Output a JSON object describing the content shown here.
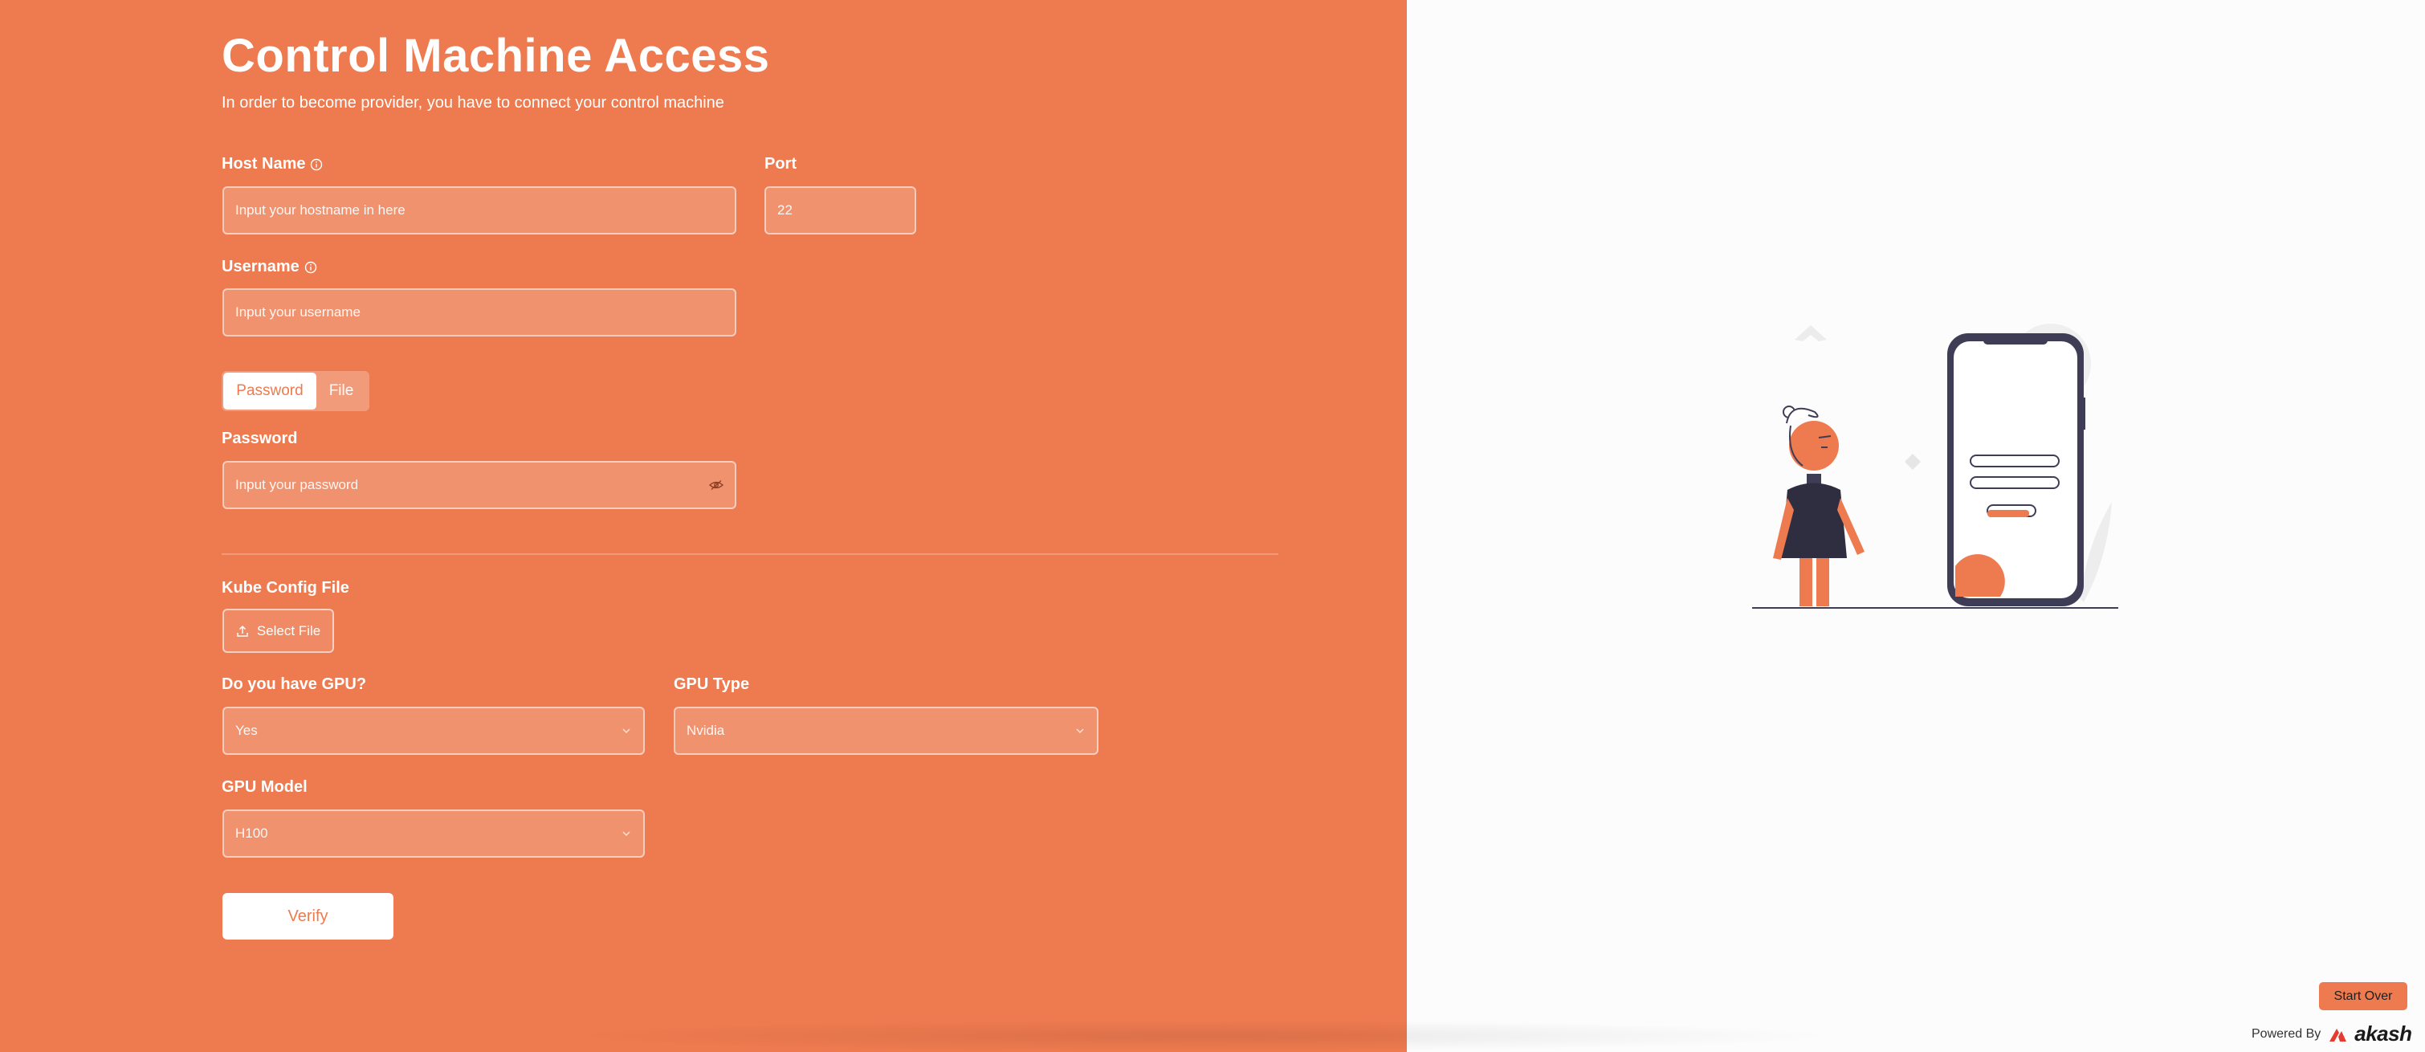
{
  "page": {
    "title": "Control Machine Access",
    "subtitle": "In order to become provider, you have to connect your control machine"
  },
  "form": {
    "host_name": {
      "label": "Host Name",
      "placeholder": "Input your hostname in here"
    },
    "port": {
      "label": "Port",
      "value": "22"
    },
    "username": {
      "label": "Username",
      "placeholder": "Input your username"
    },
    "auth_tabs": {
      "active": "Password",
      "inactive": "File"
    },
    "password": {
      "label": "Password",
      "placeholder": "Input your password"
    },
    "kube_config": {
      "label": "Kube Config File",
      "button": "Select File"
    },
    "gpu": {
      "label": "Do you have GPU?",
      "value": "Yes"
    },
    "gpu_type": {
      "label": "GPU Type",
      "value": "Nvidia"
    },
    "gpu_model": {
      "label": "GPU Model",
      "value": "H100"
    },
    "verify_label": "Verify"
  },
  "footer": {
    "start_over_label": "Start Over",
    "powered_by_label": "Powered By",
    "brand_name": "akash"
  },
  "colors": {
    "brand": "#ee7a4f",
    "dark": "#3f3d56",
    "white": "#ffffff"
  },
  "icons": [
    "info-icon",
    "eye-slash-icon",
    "upload-icon",
    "chevron-down-icon",
    "akash-logo-icon"
  ]
}
